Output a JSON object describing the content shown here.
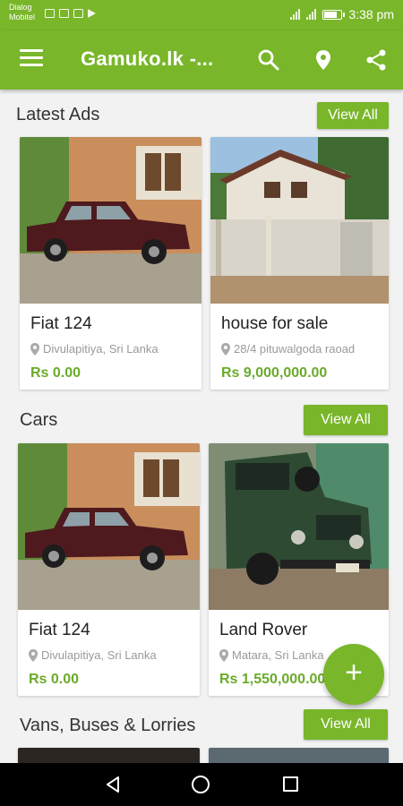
{
  "status_bar": {
    "carrier_line1": "Dialog",
    "carrier_line2": "Mobitel",
    "time": "3:38 pm"
  },
  "app_bar": {
    "title": "Gamuko.lk -...",
    "icons": [
      "menu-icon",
      "search-icon",
      "location-icon",
      "share-icon"
    ]
  },
  "colors": {
    "primary": "#79b62a",
    "price": "#6aab2a"
  },
  "sections": [
    {
      "title": "Latest Ads",
      "view_all": "View All",
      "ads": [
        {
          "title": "Fiat 124",
          "location": "Divulapitiya, Sri Lanka",
          "price": "Rs 0.00"
        },
        {
          "title": "house for sale",
          "location": "28/4 pituwalgoda raoad",
          "price": "Rs 9,000,000.00"
        }
      ]
    },
    {
      "title": "Cars",
      "view_all": "View All",
      "ads": [
        {
          "title": "Fiat 124",
          "location": "Divulapitiya, Sri Lanka",
          "price": "Rs 0.00"
        },
        {
          "title": "Land Rover",
          "location": "Matara, Sri Lanka",
          "price": "Rs 1,550,000.00"
        }
      ]
    },
    {
      "title": "Vans, Buses & Lorries",
      "view_all": "View All"
    }
  ],
  "fab": {
    "label": "+"
  }
}
